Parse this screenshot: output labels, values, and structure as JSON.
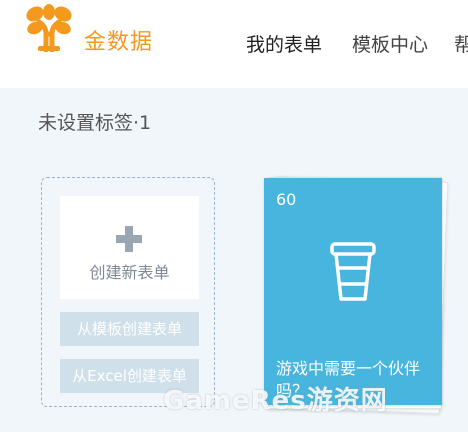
{
  "colors": {
    "brand": "#f39a1e",
    "card": "#47b5dd",
    "sub_button": "#cfe0ea"
  },
  "header": {
    "logo_text": "金数据",
    "nav": [
      "我的表单",
      "模板中心",
      "帮"
    ]
  },
  "label_count": "未设置标签·1",
  "create": {
    "new_form": "创建新表单",
    "from_template": "从模板创建表单",
    "from_excel": "从Excel创建表单"
  },
  "card": {
    "count": "60",
    "icon": "cup-icon",
    "title": "游戏中需要一个伙伴吗？"
  },
  "watermark": "GameRes游资网"
}
